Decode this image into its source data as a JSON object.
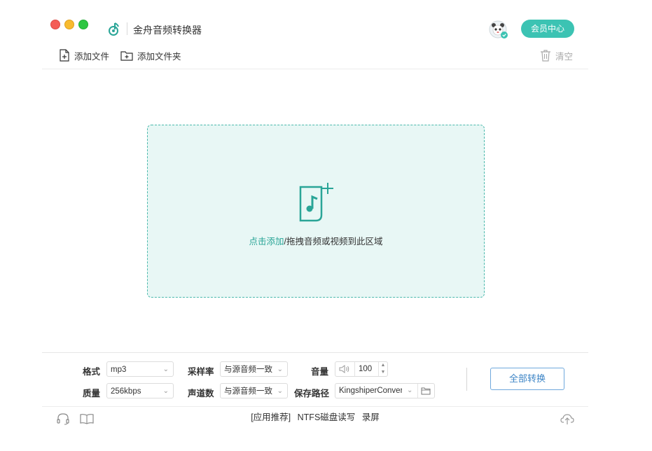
{
  "app": {
    "title": "金舟音频转换器",
    "vip_label": "会员中心"
  },
  "toolbar": {
    "add_file": "添加文件",
    "add_folder": "添加文件夹",
    "clear": "清空"
  },
  "dropzone": {
    "link_text": "点击添加",
    "rest_text": "/拖拽音频或视频到此区域"
  },
  "settings": {
    "format_label": "格式",
    "format_value": "mp3",
    "quality_label": "质量",
    "quality_value": "256kbps",
    "samplerate_label": "采样率",
    "samplerate_value": "与源音频一致",
    "channels_label": "声道数",
    "channels_value": "与源音频一致",
    "volume_label": "音量",
    "volume_value": "100",
    "savepath_label": "保存路径",
    "savepath_value": "KingshiperConver"
  },
  "convert_all": "全部转换",
  "footer": {
    "rec_label": "[应用推荐]",
    "link_ntfs": "NTFS磁盘读写",
    "link_record": "录屏"
  },
  "colors": {
    "accent": "#3cc3b3",
    "dropzone_bg": "#e8f7f5",
    "link": "#2aa597",
    "button_blue": "#3d85c6"
  }
}
